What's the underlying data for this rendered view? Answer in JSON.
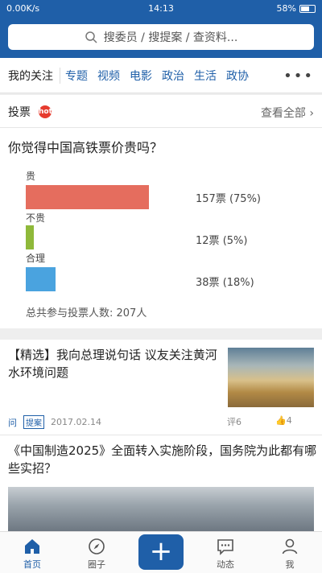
{
  "status": {
    "left": "0.00K/s",
    "time": "14:13",
    "battery": "58%"
  },
  "search": {
    "placeholder": "搜委员 / 搜提案 / 查资料..."
  },
  "nav": {
    "first": "我的关注",
    "channels": [
      "专题",
      "视频",
      "电影",
      "政治",
      "生活",
      "政协"
    ],
    "more": "•••"
  },
  "vote": {
    "section": "投票",
    "hot_badge": "hot",
    "view_all": "查看全部",
    "question": "你觉得中国高铁票价贵吗？",
    "options": [
      {
        "label": "贵",
        "votes": "157票",
        "percent": "(75%)",
        "value": 75,
        "color": "#e56d5e"
      },
      {
        "label": "不贵",
        "votes": "12票",
        "percent": "(5%)",
        "value": 5,
        "color": "#8fb93a"
      },
      {
        "label": "合理",
        "votes": "38票",
        "percent": "(18%)",
        "value": 18,
        "color": "#4aa3df"
      }
    ],
    "total": "总共参与投票人数: 207人"
  },
  "news": [
    {
      "title": "【精选】我向总理说句话 议友关注黄河水环境问题",
      "tag1": "问",
      "tag2": "提案",
      "date": "2017.02.14",
      "comments": "评6",
      "likes": "4"
    },
    {
      "title": "《中国制造2025》全面转入实施阶段，国务院为此都有哪些实招？"
    }
  ],
  "tabbar": {
    "home": "首页",
    "circle": "圈子",
    "dynamics": "动态",
    "me": "我",
    "plus": "+"
  },
  "colors": {
    "brand": "#1f5fa8"
  }
}
